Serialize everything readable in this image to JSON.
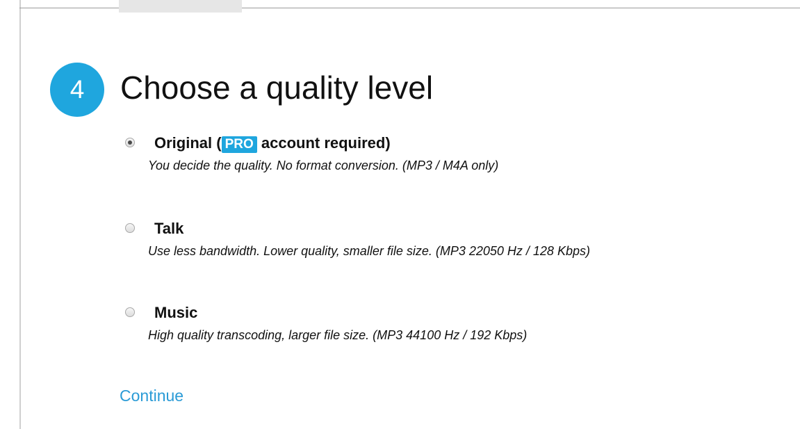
{
  "step": {
    "number": "4",
    "title": "Choose a quality level"
  },
  "options": [
    {
      "label_before": "Original (",
      "badge": "PRO",
      "label_after": " account required)",
      "description": "You decide the quality. No format conversion. (MP3 / M4A only)",
      "selected": true
    },
    {
      "label": "Talk",
      "description": "Use less bandwidth. Lower quality, smaller file size. (MP3 22050 Hz / 128 Kbps)",
      "selected": false
    },
    {
      "label": "Music",
      "description": "High quality transcoding, larger file size. (MP3 44100 Hz / 192 Kbps)",
      "selected": false
    }
  ],
  "continue_label": "Continue",
  "colors": {
    "accent": "#1fa6de",
    "link": "#2b9bd6"
  }
}
